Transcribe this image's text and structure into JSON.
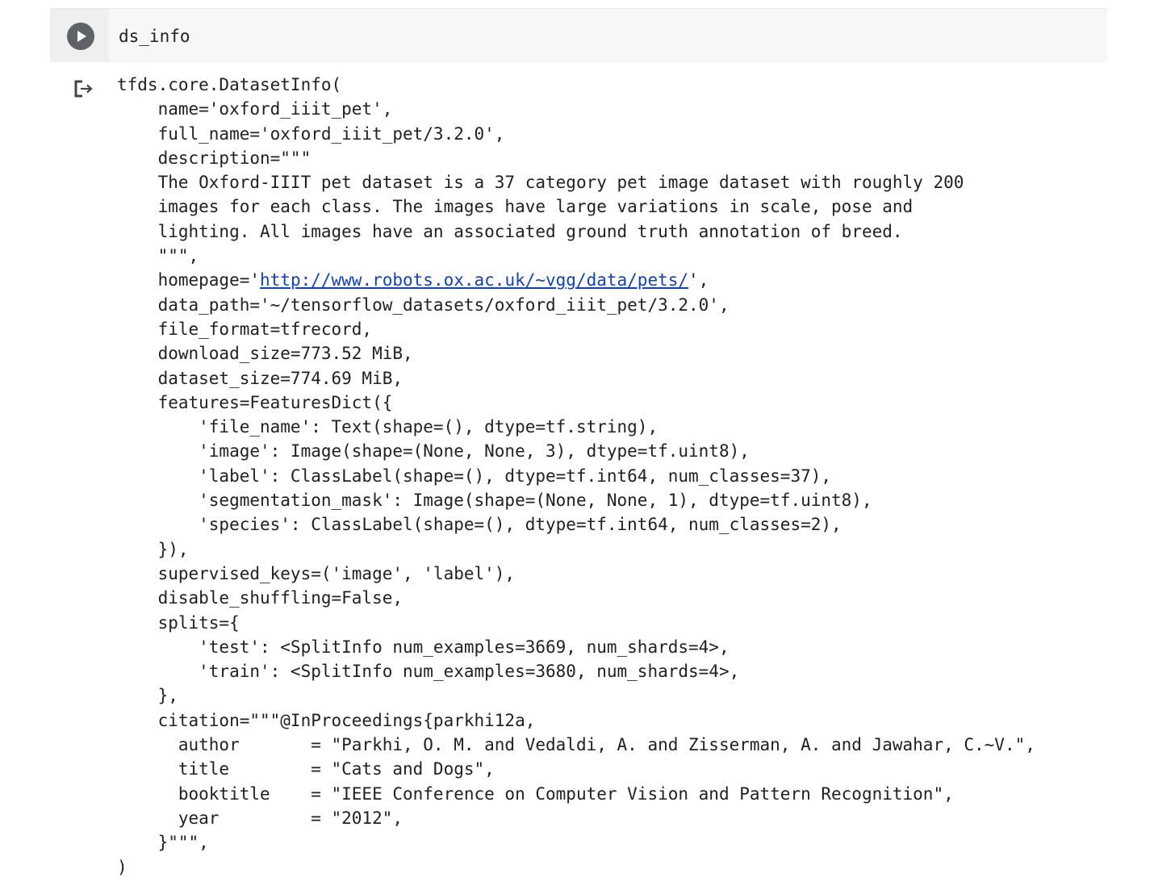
{
  "cell": {
    "code": "ds_info"
  },
  "output": {
    "line_01": "tfds.core.DatasetInfo(",
    "line_02": "    name='oxford_iiit_pet',",
    "line_03": "    full_name='oxford_iiit_pet/3.2.0',",
    "line_04": "    description=\"\"\"",
    "line_05": "    The Oxford-IIIT pet dataset is a 37 category pet image dataset with roughly 200",
    "line_06": "    images for each class. The images have large variations in scale, pose and",
    "line_07": "    lighting. All images have an associated ground truth annotation of breed.",
    "line_08": "    \"\"\",",
    "homepage_prefix": "    homepage='",
    "homepage_url": "http://www.robots.ox.ac.uk/~vgg/data/pets/",
    "homepage_suffix": "',",
    "line_10": "    data_path='~/tensorflow_datasets/oxford_iiit_pet/3.2.0',",
    "line_11": "    file_format=tfrecord,",
    "line_12": "    download_size=773.52 MiB,",
    "line_13": "    dataset_size=774.69 MiB,",
    "line_14": "    features=FeaturesDict({",
    "line_15": "        'file_name': Text(shape=(), dtype=tf.string),",
    "line_16": "        'image': Image(shape=(None, None, 3), dtype=tf.uint8),",
    "line_17": "        'label': ClassLabel(shape=(), dtype=tf.int64, num_classes=37),",
    "line_18": "        'segmentation_mask': Image(shape=(None, None, 1), dtype=tf.uint8),",
    "line_19": "        'species': ClassLabel(shape=(), dtype=tf.int64, num_classes=2),",
    "line_20": "    }),",
    "line_21": "    supervised_keys=('image', 'label'),",
    "line_22": "    disable_shuffling=False,",
    "line_23": "    splits={",
    "line_24": "        'test': <SplitInfo num_examples=3669, num_shards=4>,",
    "line_25": "        'train': <SplitInfo num_examples=3680, num_shards=4>,",
    "line_26": "    },",
    "line_27": "    citation=\"\"\"@InProceedings{parkhi12a,",
    "line_28": "      author       = \"Parkhi, O. M. and Vedaldi, A. and Zisserman, A. and Jawahar, C.~V.\",",
    "line_29": "      title        = \"Cats and Dogs\",",
    "line_30": "      booktitle    = \"IEEE Conference on Computer Vision and Pattern Recognition\",",
    "line_31": "      year         = \"2012\",",
    "line_32": "    }\"\"\",",
    "line_33": ")"
  },
  "icons": {
    "run": "play-icon",
    "output": "output-arrow-icon"
  },
  "colors": {
    "cell_background": "#f7f7f7",
    "gutter_background": "#efefef",
    "run_button": "#5f6368",
    "link": "#0d3fd6",
    "text": "#212121"
  }
}
